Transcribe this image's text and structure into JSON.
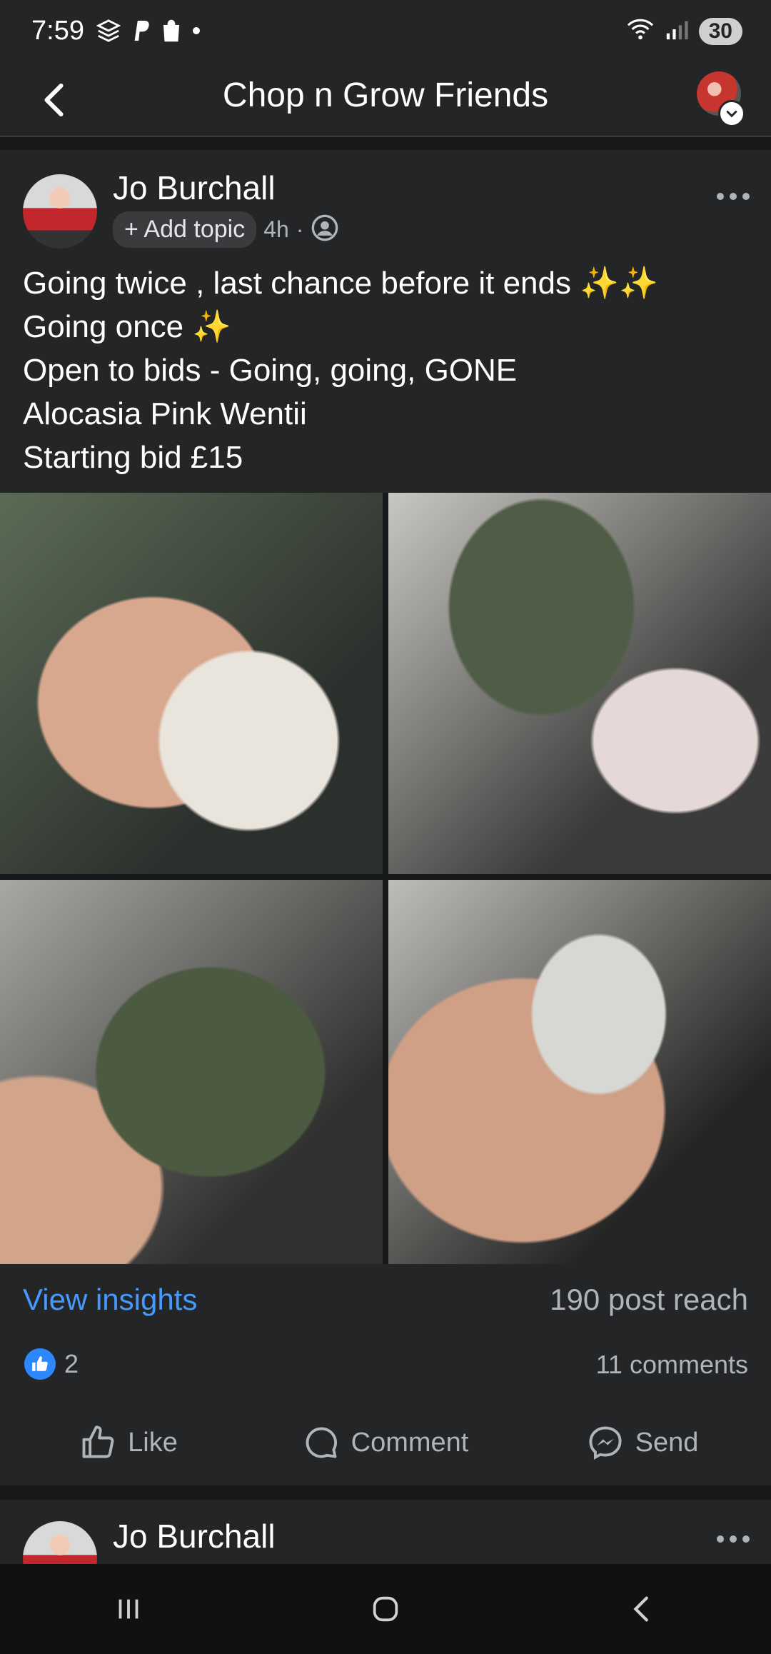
{
  "status": {
    "time": "7:59",
    "battery": "30"
  },
  "header": {
    "title": "Chop n Grow Friends"
  },
  "post": {
    "author": "Jo Burchall",
    "add_topic": "+ Add topic",
    "time": "4h",
    "separator": "·",
    "text_lines": [
      "Going twice , last chance before it ends ✨✨",
      "Going once ✨",
      "Open to bids - Going, going, GONE",
      "Alocasia Pink Wentii",
      "Starting bid £15"
    ],
    "view_insights": "View insights",
    "post_reach": "190 post reach",
    "reaction_count": "2",
    "comments": "11 comments",
    "actions": {
      "like": "Like",
      "comment": "Comment",
      "send": "Send"
    }
  },
  "next_post": {
    "author": "Jo Burchall"
  },
  "colors": {
    "link_blue": "#4599ff",
    "like_blue": "#2d88ff",
    "surface": "#242526",
    "background": "#18191a"
  }
}
